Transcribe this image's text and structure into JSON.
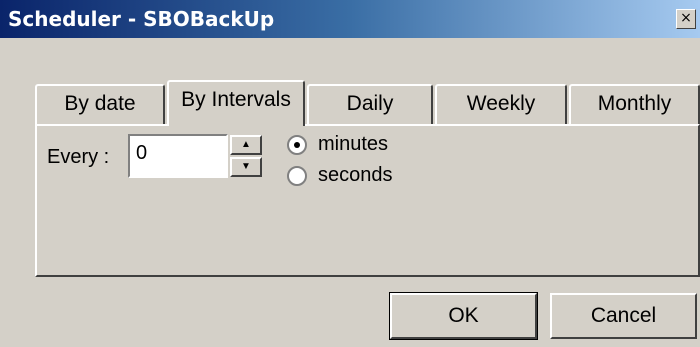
{
  "window": {
    "title": "Scheduler - SBOBackUp",
    "close_glyph": "×"
  },
  "tabs": [
    {
      "label": "By date",
      "active": false
    },
    {
      "label": "By Intervals",
      "active": true
    },
    {
      "label": "Daily",
      "active": false
    },
    {
      "label": "Weekly",
      "active": false
    },
    {
      "label": "Monthly",
      "active": false
    }
  ],
  "interval": {
    "label": "Every :",
    "value": "0",
    "spin_up_glyph": "▲",
    "spin_down_glyph": "▼"
  },
  "units": {
    "options": [
      {
        "label": "minutes",
        "selected": true
      },
      {
        "label": "seconds",
        "selected": false
      }
    ]
  },
  "buttons": {
    "ok": "OK",
    "cancel": "Cancel"
  },
  "colors": {
    "face": "#d4d0c8",
    "title_start": "#0a246a",
    "title_end": "#a6caf0"
  }
}
